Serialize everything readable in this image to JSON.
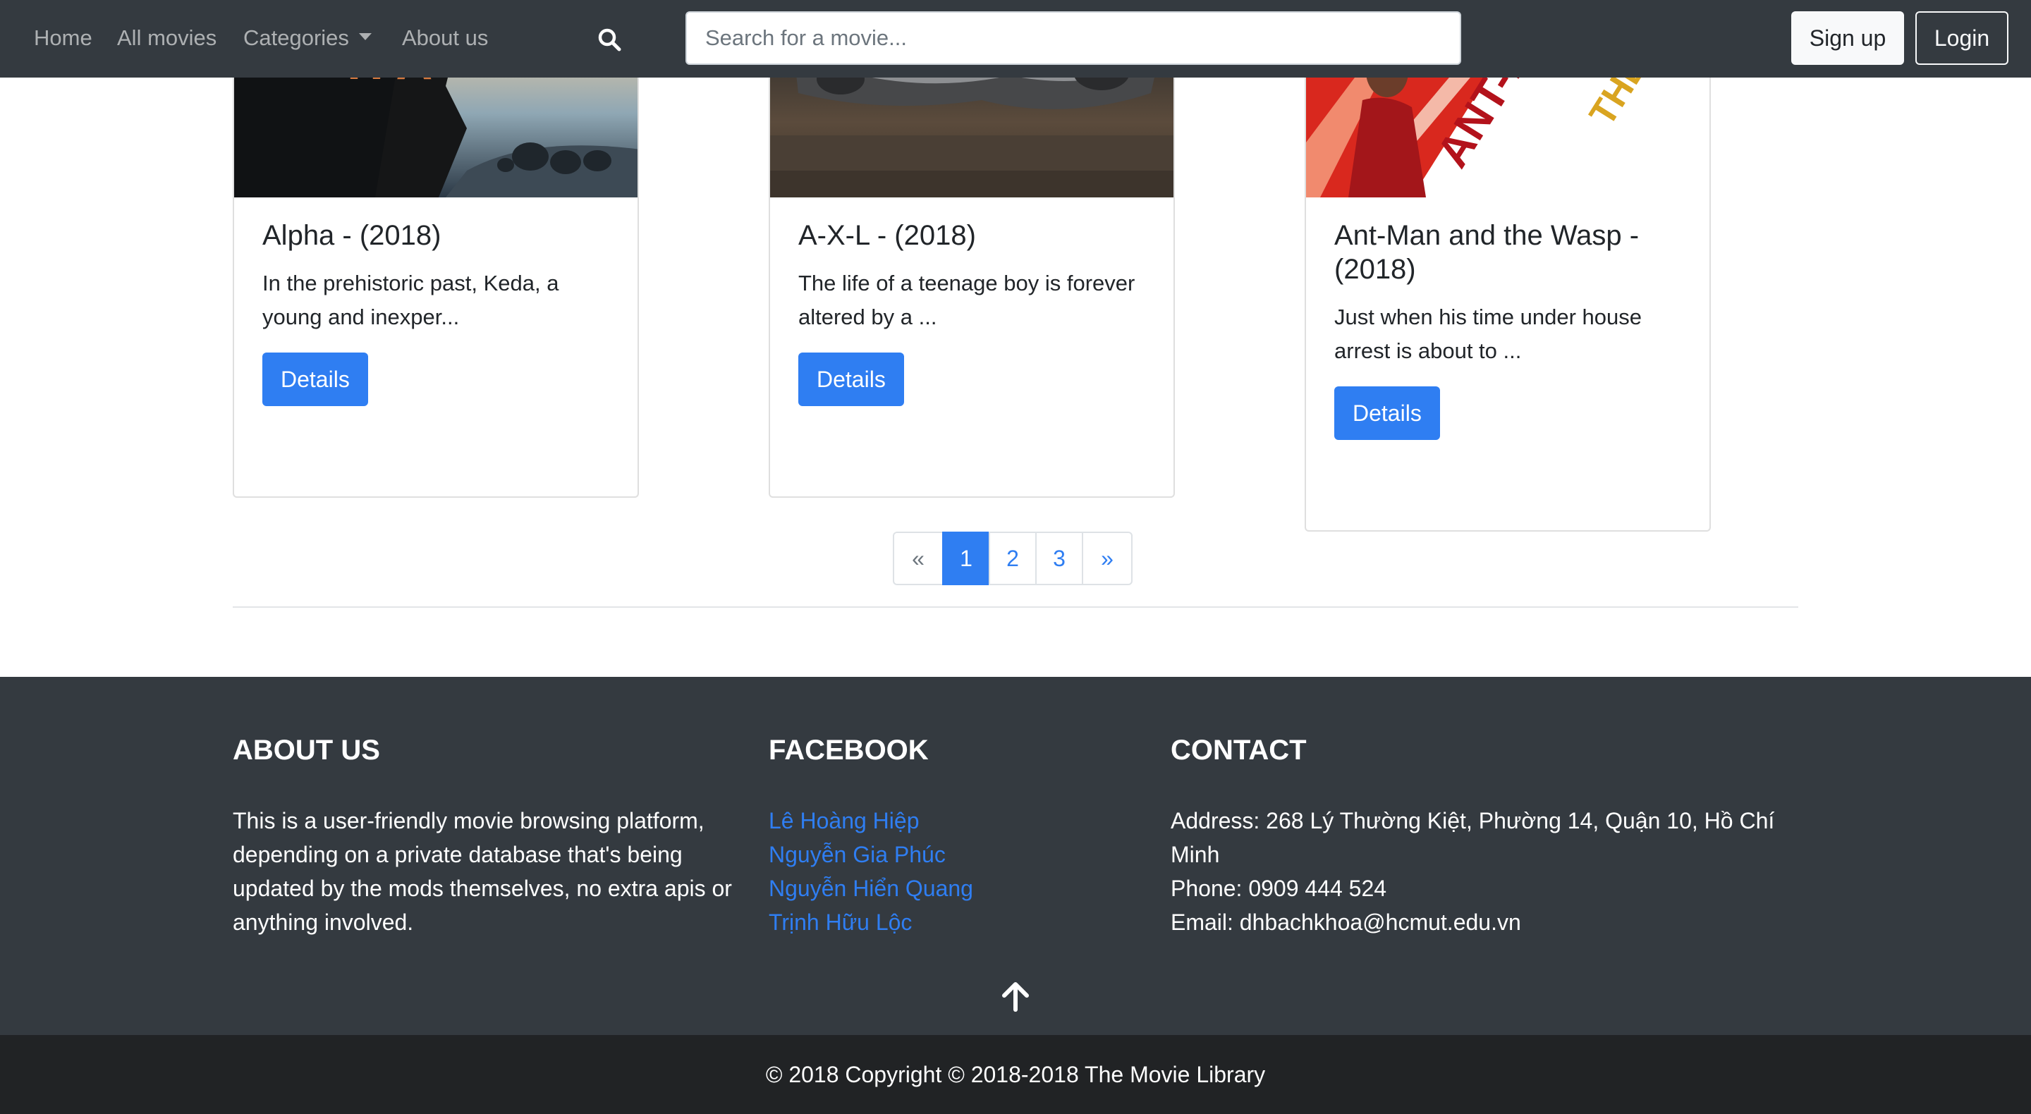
{
  "nav": {
    "links": [
      "Home",
      "All movies",
      "Categories",
      "About us"
    ],
    "search_placeholder": "Search for a movie...",
    "signup_label": "Sign up",
    "login_label": "Login"
  },
  "movies": [
    {
      "title": "Alpha - (2018)",
      "desc": "In the prehistoric past, Keda, a young and inexper...",
      "button": "Details",
      "poster_text": "H A"
    },
    {
      "title": "A-X-L - (2018)",
      "desc": "The life of a teenage boy is forever altered by a ...",
      "button": "Details"
    },
    {
      "title": "Ant-Man and the Wasp - (2018)",
      "desc": "Just when his time under house arrest is about to ...",
      "button": "Details",
      "poster_text": "ANT-MAN",
      "poster_text2": "THE WASP"
    }
  ],
  "pagination": {
    "prev": "«",
    "pages": [
      "1",
      "2",
      "3"
    ],
    "next": "»",
    "active": 1
  },
  "footer": {
    "about_heading": "ABOUT US",
    "about_text": "This is a user-friendly movie browsing platform, depending on a private database that's being updated by the mods themselves, no extra apis or anything involved.",
    "facebook_heading": "FACEBOOK",
    "facebook_links": [
      "Lê Hoàng Hiệp",
      "Nguyễn Gia Phúc",
      "Nguyễn Hiển Quang",
      "Trịnh Hữu Lộc"
    ],
    "contact_heading": "CONTACT",
    "contact_address": "Address: 268 Lý Thường Kiệt, Phường 14, Quận 10, Hồ Chí Minh",
    "contact_phone": "Phone: 0909 444 524",
    "contact_email": "Email: dhbachkhoa@hcmut.edu.vn"
  },
  "copyright": "© 2018 Copyright © 2018-2018 The Movie Library",
  "colors": {
    "navbar": "#343a40",
    "accent": "#2f7ef2",
    "footer": "#343a40",
    "copyright_bar": "#212325"
  }
}
